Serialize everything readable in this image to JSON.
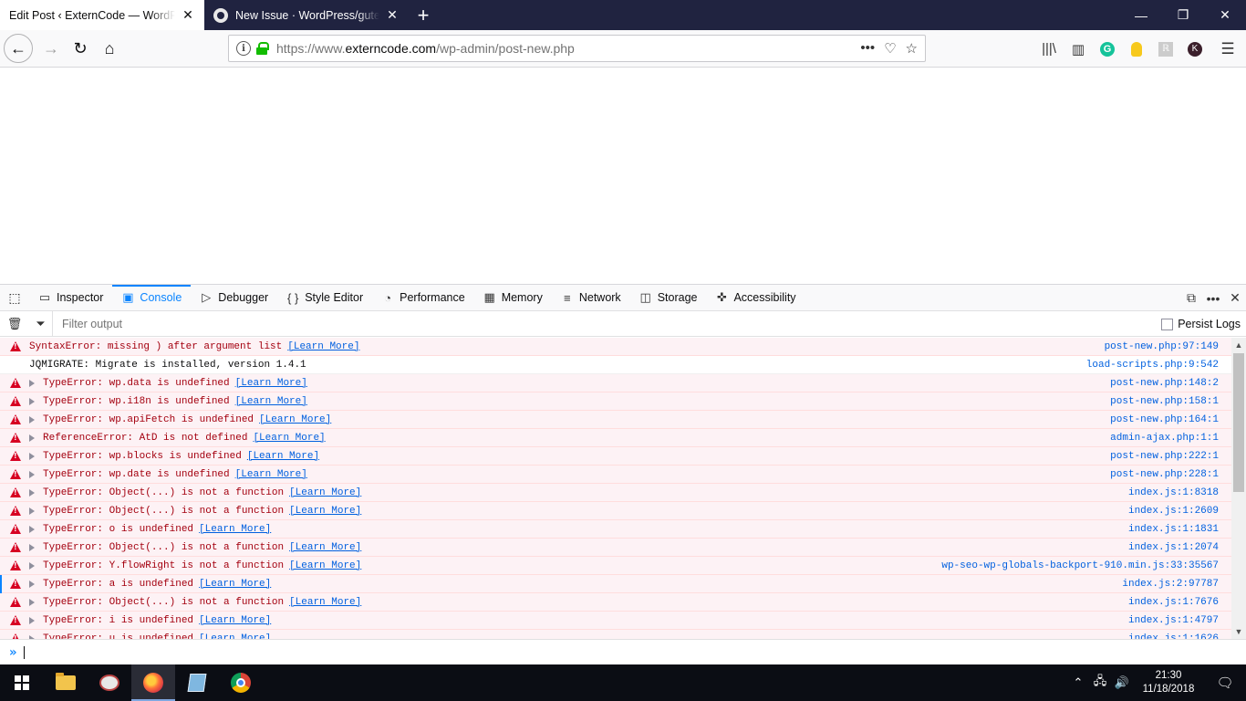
{
  "browser": {
    "tabs": [
      {
        "title": "Edit Post ‹ ExternCode — WordPress",
        "close": "✕",
        "active": true
      },
      {
        "title": "New Issue · WordPress/gutenberg",
        "close": "✕",
        "active": false
      }
    ],
    "new_tab": "+",
    "window_controls": {
      "minimize": "—",
      "restore": "❐",
      "close": "✕"
    },
    "nav": {
      "back": "←",
      "forward": "→",
      "reload": "↻",
      "home": "⌂"
    },
    "url": {
      "scheme": "https://www.",
      "host": "externcode.com",
      "path": "/wp-admin/post-new.php"
    },
    "url_icons": {
      "page_actions": "•••",
      "pocket": "♡",
      "bookmark": "☆"
    },
    "toolbar_icons": {
      "library": "|||\\",
      "sidebar": "▥",
      "grammarly": "G",
      "bulb": "",
      "ext": "ℝ",
      "profile": "K",
      "menu": "☰"
    }
  },
  "devtools": {
    "picker_icon": "⬚",
    "tabs": [
      {
        "label": "Inspector",
        "icon": "▭",
        "active": false
      },
      {
        "label": "Console",
        "icon": "▣",
        "active": true
      },
      {
        "label": "Debugger",
        "icon": "▷",
        "active": false
      },
      {
        "label": "Style Editor",
        "icon": "{ }",
        "active": false
      },
      {
        "label": "Performance",
        "icon": "◔",
        "active": false
      },
      {
        "label": "Memory",
        "icon": "▦",
        "active": false
      },
      {
        "label": "Network",
        "icon": "≡",
        "active": false
      },
      {
        "label": "Storage",
        "icon": "◫",
        "active": false
      },
      {
        "label": "Accessibility",
        "icon": "✜",
        "active": false
      }
    ],
    "right_buttons": {
      "dock": "⧉",
      "more": "•••",
      "close": "✕"
    },
    "filter": {
      "placeholder": "Filter output",
      "trash": "🗑",
      "funnel": "⏷",
      "persist_label": "Persist Logs"
    },
    "prompt": "»",
    "messages": [
      {
        "type": "error",
        "expandable": false,
        "text": "SyntaxError: missing ) after argument list",
        "learn": "[Learn More]",
        "source": "post-new.php:97:149"
      },
      {
        "type": "log",
        "expandable": false,
        "text": "JQMIGRATE: Migrate is installed, version 1.4.1",
        "learn": "",
        "source": "load-scripts.php:9:542"
      },
      {
        "type": "error",
        "expandable": true,
        "text": "TypeError: wp.data is undefined",
        "learn": "[Learn More]",
        "source": "post-new.php:148:2"
      },
      {
        "type": "error",
        "expandable": true,
        "text": "TypeError: wp.i18n is undefined",
        "learn": "[Learn More]",
        "source": "post-new.php:158:1"
      },
      {
        "type": "error",
        "expandable": true,
        "text": "TypeError: wp.apiFetch is undefined",
        "learn": "[Learn More]",
        "source": "post-new.php:164:1"
      },
      {
        "type": "error",
        "expandable": true,
        "text": "ReferenceError: AtD is not defined",
        "learn": "[Learn More]",
        "source": "admin-ajax.php:1:1"
      },
      {
        "type": "error",
        "expandable": true,
        "text": "TypeError: wp.blocks is undefined",
        "learn": "[Learn More]",
        "source": "post-new.php:222:1"
      },
      {
        "type": "error",
        "expandable": true,
        "text": "TypeError: wp.date is undefined",
        "learn": "[Learn More]",
        "source": "post-new.php:228:1"
      },
      {
        "type": "error",
        "expandable": true,
        "text": "TypeError: Object(...) is not a function",
        "learn": "[Learn More]",
        "source": "index.js:1:8318"
      },
      {
        "type": "error",
        "expandable": true,
        "text": "TypeError: Object(...) is not a function",
        "learn": "[Learn More]",
        "source": "index.js:1:2609"
      },
      {
        "type": "error",
        "expandable": true,
        "text": "TypeError: o is undefined",
        "learn": "[Learn More]",
        "source": "index.js:1:1831"
      },
      {
        "type": "error",
        "expandable": true,
        "text": "TypeError: Object(...) is not a function",
        "learn": "[Learn More]",
        "source": "index.js:1:2074"
      },
      {
        "type": "error",
        "expandable": true,
        "text": "TypeError: Y.flowRight is not a function",
        "learn": "[Learn More]",
        "source": "wp-seo-wp-globals-backport-910.min.js:33:35567"
      },
      {
        "type": "error",
        "expandable": true,
        "marked": true,
        "text": "TypeError: a is undefined",
        "learn": "[Learn More]",
        "source": "index.js:2:97787"
      },
      {
        "type": "error",
        "expandable": true,
        "text": "TypeError: Object(...) is not a function",
        "learn": "[Learn More]",
        "source": "index.js:1:7676"
      },
      {
        "type": "error",
        "expandable": true,
        "text": "TypeError: i is undefined",
        "learn": "[Learn More]",
        "source": "index.js:1:4797"
      },
      {
        "type": "error",
        "expandable": true,
        "text": "TypeError: u is undefined",
        "learn": "[Learn More]",
        "source": "index.js:1:1626"
      }
    ]
  },
  "taskbar": {
    "tray_icons": {
      "chevron": "⌃",
      "network": "🖧",
      "volume": "🔊"
    },
    "time": "21:30",
    "date": "11/18/2018",
    "notifications": "🗨"
  }
}
